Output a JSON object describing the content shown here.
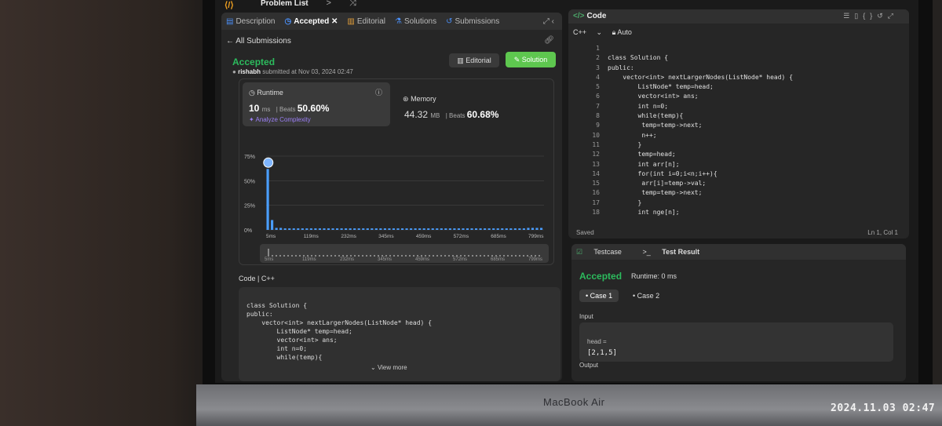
{
  "topbar": {
    "logo": "⟨/⟩",
    "title": "Problem List",
    "nav": "< > ⤨"
  },
  "left_tabs": [
    {
      "label": "Description",
      "icon": "description-icon"
    },
    {
      "label": "Accepted",
      "icon": "clock-icon"
    },
    {
      "label": "Editorial",
      "icon": "book-icon"
    },
    {
      "label": "Solutions",
      "icon": "flask-icon"
    },
    {
      "label": "Submissions",
      "icon": "history-icon"
    }
  ],
  "back_label": "All Submissions",
  "submission": {
    "status": "Accepted",
    "user": "rishabh",
    "submitted_text": "submitted at Nov 03, 2024 02:47",
    "editorial_btn": "Editorial",
    "solution_btn": "Solution"
  },
  "runtime": {
    "title": "Runtime",
    "value": "10",
    "unit": "ms",
    "beats_label": "Beats",
    "beats_value": "50.60%",
    "analyze": "Analyze Complexity"
  },
  "memory": {
    "title": "Memory",
    "value": "44.32",
    "unit": "MB",
    "beats_label": "Beats",
    "beats_value": "60.68%"
  },
  "chart_data": {
    "type": "bar",
    "ytick_labels": [
      "75%",
      "50%",
      "25%",
      "0%"
    ],
    "ylim": [
      0,
      75
    ],
    "xtick_labels": [
      "5ms",
      "119ms",
      "232ms",
      "345ms",
      "459ms",
      "572ms",
      "685ms",
      "799ms"
    ],
    "values": [
      62,
      10,
      2,
      2,
      1.5,
      1.5,
      1.5,
      1.5,
      1.5,
      1.5,
      1.5,
      1.5,
      1.5,
      1.5,
      1.5,
      1.5,
      1.5,
      1.5,
      1.5,
      1.5,
      1.5,
      1.5,
      1.5,
      1.5,
      1.5,
      1.5,
      1.5,
      1.5,
      1.5,
      1.5,
      1.5,
      1.5,
      1.5,
      1.5,
      1.5,
      1.5,
      1.5,
      1.5,
      1.5,
      1.5,
      1.5,
      1.5,
      1.5,
      1.5,
      1.5,
      1.5,
      1.5,
      1.5,
      1.5,
      1.5,
      1.5,
      1.5,
      1.5,
      1.5,
      1.5,
      1.5,
      1.5,
      1.5,
      1.5,
      1.5,
      2,
      2,
      2,
      2
    ],
    "highlight_index": 0,
    "grid": true,
    "color": "#4a9eff"
  },
  "code_section": {
    "label": "Code",
    "lang": "C++",
    "view_more": "View more"
  },
  "code_preview_lines": [
    "class Solution {",
    "public:",
    "    vector<int> nextLargerNodes(ListNode* head) {",
    "        ListNode* temp=head;",
    "        vector<int> ans;",
    "        int n=0;",
    "        while(temp){"
  ],
  "editor": {
    "title": "Code",
    "lang": "C++",
    "mode": "Auto",
    "saved": "Saved",
    "cursor": "Ln 1, Col 1",
    "line_numbers": [
      "1",
      "2",
      "3",
      "4",
      "5",
      "6",
      "7",
      "8",
      "9",
      "10",
      "11",
      "12",
      "13",
      "14",
      "15",
      "16",
      "17",
      "18"
    ],
    "lines": [
      "",
      "class Solution {",
      "public:",
      "    vector<int> nextLargerNodes(ListNode* head) {",
      "        ListNode* temp=head;",
      "        vector<int> ans;",
      "        int n=0;",
      "        while(temp){",
      "         temp=temp->next;",
      "         n++;",
      "        }",
      "        temp=head;",
      "        int arr[n];",
      "        for(int i=0;i<n;i++){",
      "         arr[i]=temp->val;",
      "         temp=temp->next;",
      "        }",
      "        int nge[n];"
    ]
  },
  "testresult": {
    "tab_testcase": "Testcase",
    "tab_result": "Test Result",
    "status": "Accepted",
    "runtime": "Runtime: 0 ms",
    "case1": "Case 1",
    "case2": "Case 2",
    "input_label": "Input",
    "input_var": "head =",
    "input_val": "[2,1,5]",
    "output_label": "Output"
  },
  "device_label": "MacBook Air",
  "photo_timestamp": "2024.11.03 02:47"
}
